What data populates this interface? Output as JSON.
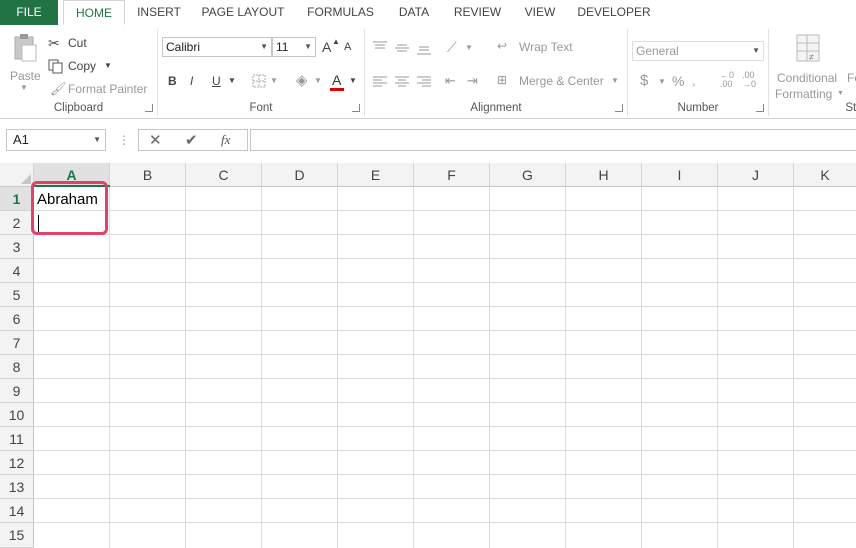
{
  "tabs": [
    "FILE",
    "HOME",
    "INSERT",
    "PAGE LAYOUT",
    "FORMULAS",
    "DATA",
    "REVIEW",
    "VIEW",
    "DEVELOPER"
  ],
  "clipboard": {
    "paste": "Paste",
    "cut": "Cut",
    "copy": "Copy",
    "format_painter": "Format Painter",
    "label": "Clipboard"
  },
  "font": {
    "name": "Calibri",
    "size": "11",
    "bold": "B",
    "italic": "I",
    "underline": "U",
    "grow": "A",
    "shrink": "A",
    "color": "A",
    "label": "Font"
  },
  "alignment": {
    "wrap_text": "Wrap Text",
    "merge_center": "Merge & Center",
    "label": "Alignment"
  },
  "number": {
    "format": "General",
    "currency": "$",
    "percent": "%",
    "label": "Number"
  },
  "styles": {
    "conditional_formatting_1": "Conditional",
    "conditional_formatting_2": "Formatting",
    "format_as_table": "Fo",
    "label": "Sty"
  },
  "formula_bar": {
    "name_box": "A1",
    "fx": "fx",
    "value": ""
  },
  "columns": [
    "A",
    "B",
    "C",
    "D",
    "E",
    "F",
    "G",
    "H",
    "I",
    "J",
    "K"
  ],
  "rows": [
    "1",
    "2",
    "3",
    "4",
    "5",
    "6",
    "7",
    "8",
    "9",
    "10",
    "11",
    "12",
    "13",
    "14",
    "15"
  ],
  "cells": {
    "A1": "Abraham",
    "A2": ""
  },
  "colors": {
    "accent": "#217346",
    "highlight": "#e0436a"
  }
}
